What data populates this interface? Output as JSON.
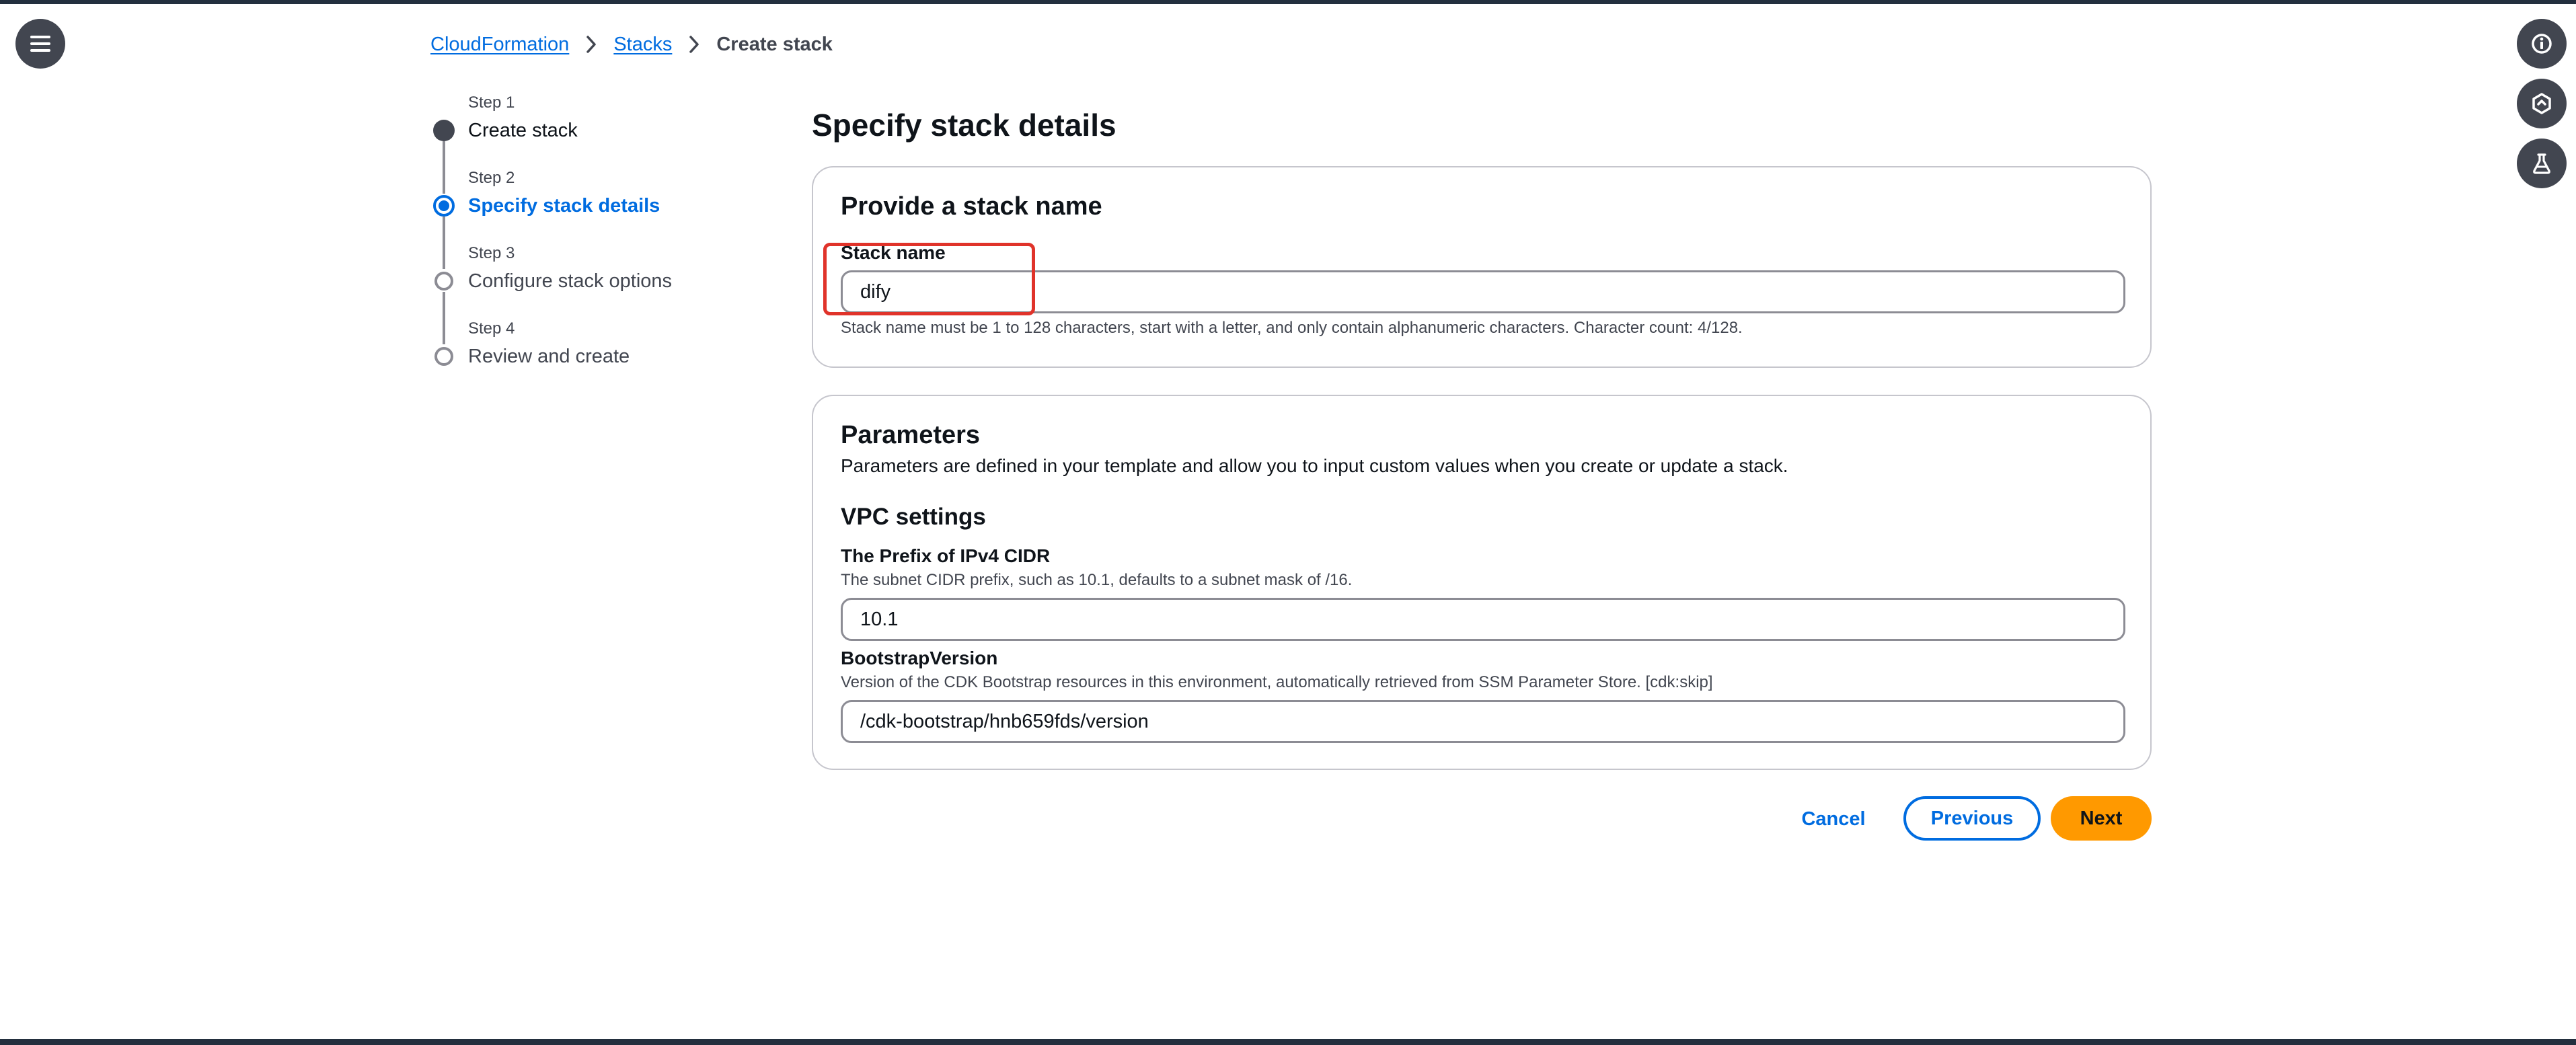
{
  "colors": {
    "accent": "#006ce0",
    "primary_button": "#ff9900",
    "annotation": "#e0332a",
    "nav_button": "#424650"
  },
  "nav": {
    "menu_icon": "hamburger-menu-icon",
    "right_icons": [
      "info-icon",
      "feedback-icon",
      "lab-flask-icon"
    ]
  },
  "breadcrumb": {
    "items": [
      "CloudFormation",
      "Stacks",
      "Create stack"
    ]
  },
  "steps": [
    {
      "step": "Step 1",
      "title": "Create stack",
      "state": "completed"
    },
    {
      "step": "Step 2",
      "title": "Specify stack details",
      "state": "current"
    },
    {
      "step": "Step 3",
      "title": "Configure stack options",
      "state": "upcoming"
    },
    {
      "step": "Step 4",
      "title": "Review and create",
      "state": "upcoming"
    }
  ],
  "page_title": "Specify stack details",
  "stack_name_panel": {
    "heading": "Provide a stack name",
    "label": "Stack name",
    "value": "dify",
    "hint": "Stack name must be 1 to 128 characters, start with a letter, and only contain alphanumeric characters. Character count: 4/128."
  },
  "parameters_panel": {
    "heading": "Parameters",
    "description": "Parameters are defined in your template and allow you to input custom values when you create or update a stack.",
    "section_heading": "VPC settings",
    "fields": [
      {
        "label": "The Prefix of IPv4 CIDR",
        "description": "The subnet CIDR prefix, such as 10.1, defaults to a subnet mask of /16.",
        "value": "10.1"
      },
      {
        "label": "BootstrapVersion",
        "description": "Version of the CDK Bootstrap resources in this environment, automatically retrieved from SSM Parameter Store. [cdk:skip]",
        "value": "/cdk-bootstrap/hnb659fds/version"
      }
    ]
  },
  "actions": {
    "cancel": "Cancel",
    "previous": "Previous",
    "next": "Next"
  }
}
